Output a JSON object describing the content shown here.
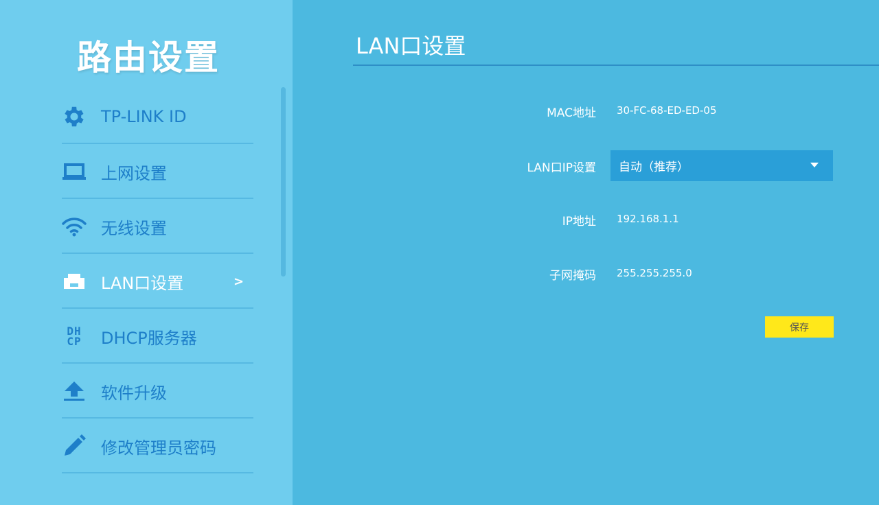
{
  "sidebar": {
    "title": "路由设置",
    "items": [
      {
        "label": "TP-LINK ID",
        "icon": "gear-icon"
      },
      {
        "label": "上网设置",
        "icon": "laptop-icon"
      },
      {
        "label": "无线设置",
        "icon": "wifi-icon"
      },
      {
        "label": "LAN口设置",
        "icon": "lan-icon",
        "active": true,
        "chevron": ">"
      },
      {
        "label": "DHCP服务器",
        "icon": "dhcp-icon",
        "icon_text_top": "DH",
        "icon_text_bottom": "CP"
      },
      {
        "label": "软件升级",
        "icon": "upload-icon"
      },
      {
        "label": "修改管理员密码",
        "icon": "pencil-icon"
      }
    ]
  },
  "main": {
    "title": "LAN口设置",
    "fields": {
      "mac": {
        "label": "MAC地址",
        "value": "30-FC-68-ED-ED-05"
      },
      "lan_ip_mode": {
        "label": "LAN口IP设置",
        "value": "自动（推荐）"
      },
      "ip": {
        "label": "IP地址",
        "value": "192.168.1.1"
      },
      "subnet": {
        "label": "子网掩码",
        "value": "255.255.255.0"
      }
    },
    "save_label": "保存"
  },
  "colors": {
    "sidebar_bg": "#6fcdee",
    "main_bg": "#4cb9e0",
    "accent_text": "#1e7fc9",
    "select_bg": "#2a9fd8",
    "save_button": "#ffe81a"
  }
}
